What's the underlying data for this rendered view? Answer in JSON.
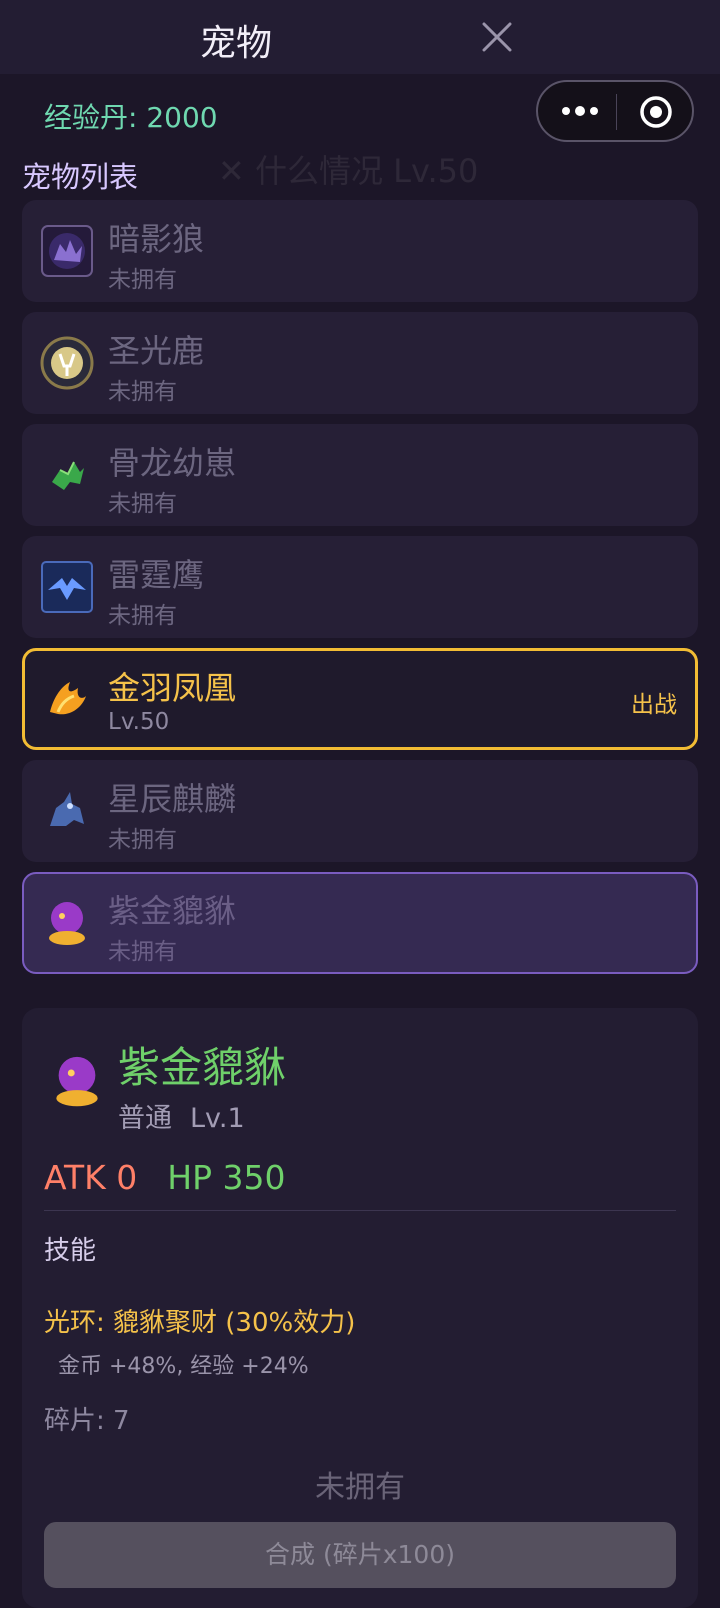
{
  "header": {
    "title": "宠物"
  },
  "exp_label": "经验丹: 2000",
  "list_title": "宠物列表",
  "watermark": "✕ 什么情况 Lv.50",
  "pets": [
    {
      "name": "暗影狼",
      "status": "未拥有",
      "icon": "shadow-wolf-icon"
    },
    {
      "name": "圣光鹿",
      "status": "未拥有",
      "icon": "holy-deer-icon"
    },
    {
      "name": "骨龙幼崽",
      "status": "未拥有",
      "icon": "bone-dragon-icon"
    },
    {
      "name": "雷霆鹰",
      "status": "未拥有",
      "icon": "thunder-eagle-icon"
    },
    {
      "name": "金羽凤凰",
      "status": "Lv.50",
      "icon": "golden-phoenix-icon",
      "action": "出战"
    },
    {
      "name": "星辰麒麟",
      "status": "未拥有",
      "icon": "star-qilin-icon"
    },
    {
      "name": "紫金貔貅",
      "status": "未拥有",
      "icon": "purple-pixiu-icon"
    }
  ],
  "detail": {
    "name": "紫金貔貅",
    "rarity": "普通",
    "level": "Lv.1",
    "atk": "ATK 0",
    "hp": "HP 350",
    "skill_title": "技能",
    "aura": "光环: 貔貅聚财 (30%效力)",
    "aura_effect": "金币 +48%, 经验 +24%",
    "shards": "碎片: 7",
    "owned_status": "未拥有",
    "synth_button": "合成 (碎片x100)"
  },
  "colors": {
    "accent_gold": "#f5c24a",
    "accent_green": "#6fd06a",
    "exp_teal": "#6fd8b0",
    "atk_red": "#ff8068",
    "select_purple": "#7a5cc0"
  }
}
